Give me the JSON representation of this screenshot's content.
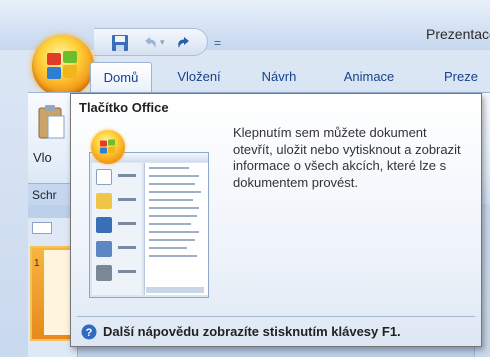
{
  "window": {
    "title": "Prezentace"
  },
  "ribbon": {
    "tabs": [
      {
        "label": "Domů",
        "active": true
      },
      {
        "label": "Vložení",
        "active": false
      },
      {
        "label": "Návrh",
        "active": false
      },
      {
        "label": "Animace",
        "active": false
      },
      {
        "label": "Preze",
        "active": false
      }
    ],
    "paste_label": "Vlo",
    "clipboard_group_label": "Schr"
  },
  "quick_access": {
    "icons": [
      "save-icon",
      "undo-icon",
      "redo-icon",
      "customize-icon"
    ],
    "separator_glyph": "="
  },
  "tooltip": {
    "title": "Tlačítko Office",
    "body": "Klepnutím sem můžete dokument otevřít, uložit nebo vytisknout a zobrazit informace o všech akcích, které lze s dokumentem provést.",
    "footer": "Další nápovědu zobrazíte stisknutím klávesy F1."
  },
  "slides_panel": {
    "slide_number": "1"
  },
  "colors": {
    "ribbon_text": "#15428b",
    "office_button": "#f08a10",
    "slide_thumbnail": "#e8891c"
  }
}
